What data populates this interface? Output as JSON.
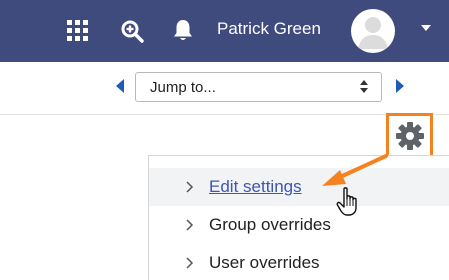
{
  "navbar": {
    "apps_icon": "grid-icon",
    "search_icon": "search-zoom-icon",
    "notifications_icon": "bell-icon",
    "user_name": "Patrick Green",
    "avatar_icon": "avatar-icon",
    "menu_icon": "caret-down-icon",
    "background_color": "#3f4a7d"
  },
  "jump": {
    "prev_icon": "triangle-left-icon",
    "next_icon": "triangle-right-icon",
    "selected": "Jump to..."
  },
  "settings": {
    "icon": "gear-icon",
    "highlight_color": "#f58220"
  },
  "menu": {
    "items": [
      {
        "label": "Edit settings",
        "state": "hover"
      },
      {
        "label": "Group overrides"
      },
      {
        "label": "User overrides"
      }
    ]
  },
  "annotation": {
    "arrow_icon": "orange-arrow-icon",
    "cursor_icon": "hand-cursor-icon"
  }
}
